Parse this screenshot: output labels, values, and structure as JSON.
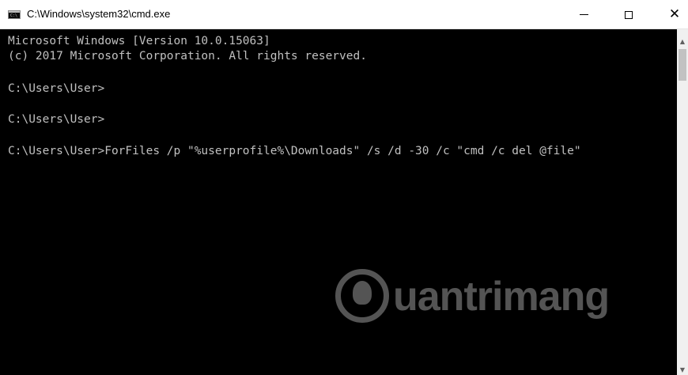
{
  "window": {
    "title": "C:\\Windows\\system32\\cmd.exe",
    "minimize_glyph": "",
    "close_glyph": "✕"
  },
  "console": {
    "lines": [
      "Microsoft Windows [Version 10.0.15063]",
      "(c) 2017 Microsoft Corporation. All rights reserved.",
      "",
      "C:\\Users\\User>",
      "",
      "C:\\Users\\User>",
      "",
      "C:\\Users\\User>ForFiles /p \"%userprofile%\\Downloads\" /s /d -30 /c \"cmd /c del @file\""
    ]
  },
  "scrollbar": {
    "up_glyph": "▲",
    "down_glyph": "▼"
  },
  "watermark": {
    "text": "uantrimang"
  },
  "colors": {
    "console_bg": "#000000",
    "console_text": "#c0c0c0",
    "titlebar_bg": "#ffffff"
  }
}
